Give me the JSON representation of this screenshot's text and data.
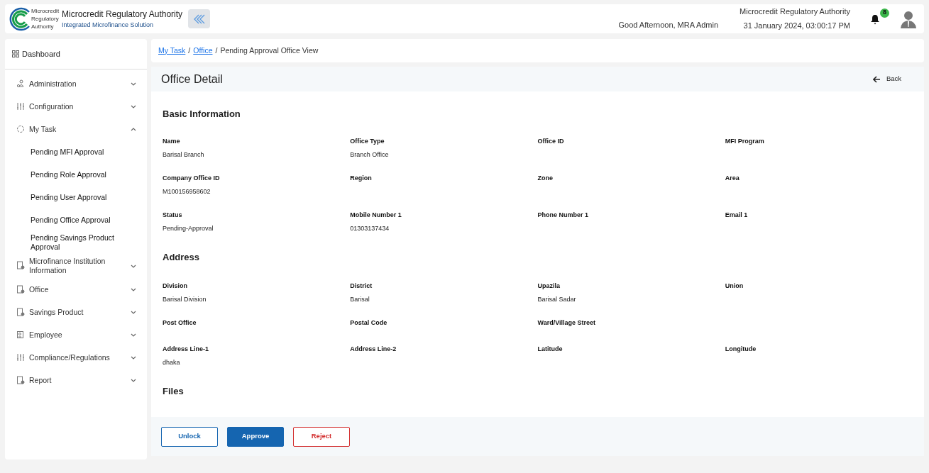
{
  "header": {
    "logo_text": "Microcredit Regulatory Authority",
    "title": "Microcredit Regulatory Authority",
    "subtitle": "Integrated Microfinance Solution",
    "greeting": "Good Afternoon, MRA Admin",
    "org": "Microcredit Regulatory Authority",
    "datetime": "31 January 2024, 03:00:17 PM",
    "notifications": "8"
  },
  "sidebar": {
    "dashboard": "Dashboard",
    "items": [
      {
        "label": "Administration",
        "expanded": false
      },
      {
        "label": "Configuration",
        "expanded": false
      },
      {
        "label": "My Task",
        "expanded": true,
        "children": [
          {
            "label": "Pending MFI Approval"
          },
          {
            "label": "Pending Role Approval"
          },
          {
            "label": "Pending User Approval"
          },
          {
            "label": "Pending Office Approval"
          },
          {
            "label": "Pending Savings Product Approval"
          }
        ]
      },
      {
        "label": "Microfinance Institution Information",
        "expanded": false
      },
      {
        "label": "Office",
        "expanded": false
      },
      {
        "label": "Savings Product",
        "expanded": false
      },
      {
        "label": "Employee",
        "expanded": false
      },
      {
        "label": "Compliance/Regulations",
        "expanded": false
      },
      {
        "label": "Report",
        "expanded": false
      }
    ]
  },
  "breadcrumb": [
    {
      "label": "My Task",
      "link": true
    },
    {
      "separator": "/",
      "label": "Office",
      "link": true
    },
    {
      "separator": "/",
      "label": "Pending Approval Office View",
      "link": false
    }
  ],
  "page_title": "Office Detail",
  "back": "Back",
  "sections": [
    {
      "title": "Basic Information",
      "rows": [
        [
          {
            "label": "Name",
            "value": "Barisal Branch"
          },
          {
            "label": "Office Type",
            "value": "Branch Office"
          },
          {
            "label": "Office ID"
          },
          {
            "label": "MFI Program"
          }
        ],
        [
          {
            "label": "Company Office ID",
            "value": "M100156958602"
          },
          {
            "label": "Region"
          },
          {
            "label": "Zone"
          },
          {
            "label": "Area"
          }
        ],
        [
          {
            "label": "Status",
            "value": "Pending-Approval"
          },
          {
            "label": "Mobile Number 1",
            "value": "01303137434"
          },
          {
            "label": "Phone Number 1"
          },
          {
            "label": "Email 1"
          }
        ]
      ]
    },
    {
      "title": "Address",
      "rows": [
        [
          {
            "label": "Division",
            "value": "Barisal Division"
          },
          {
            "label": "District",
            "value": "Barisal"
          },
          {
            "label": "Upazila",
            "value": "Barisal Sadar"
          },
          {
            "label": "Union"
          }
        ],
        [
          {
            "label": "Post Office"
          },
          {
            "label": "Postal Code"
          },
          {
            "label": "Ward/Village Street"
          }
        ],
        [
          {
            "label": "Address Line-1",
            "value": "dhaka"
          },
          {
            "label": "Address Line-2"
          },
          {
            "label": "Latitude"
          },
          {
            "label": "Longitude"
          }
        ]
      ]
    },
    {
      "title": "Files"
    }
  ],
  "actions": [
    {
      "label": "Unlock",
      "kind": "outline"
    },
    {
      "label": "Approve",
      "kind": "primary"
    },
    {
      "label": "Reject",
      "kind": "danger"
    }
  ]
}
